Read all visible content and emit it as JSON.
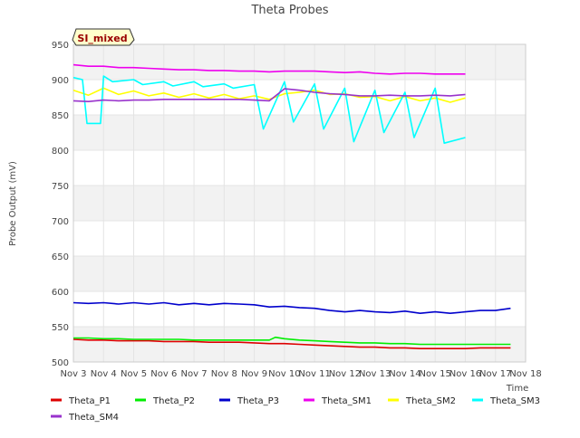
{
  "chart_data": {
    "type": "line",
    "title": "Theta Probes",
    "xlabel": "Time",
    "ylabel": "Probe Output (mV)",
    "annotation": "SI_mixed",
    "xlim": [
      3,
      18
    ],
    "ylim": [
      500,
      950
    ],
    "xticks": [
      {
        "v": 3,
        "label": "Nov 3"
      },
      {
        "v": 4,
        "label": "Nov 4"
      },
      {
        "v": 5,
        "label": "Nov 5"
      },
      {
        "v": 6,
        "label": "Nov 6"
      },
      {
        "v": 7,
        "label": "Nov 7"
      },
      {
        "v": 8,
        "label": "Nov 8"
      },
      {
        "v": 9,
        "label": "Nov 9"
      },
      {
        "v": 10,
        "label": "Nov 10"
      },
      {
        "v": 11,
        "label": "Nov 11"
      },
      {
        "v": 12,
        "label": "Nov 12"
      },
      {
        "v": 13,
        "label": "Nov 13"
      },
      {
        "v": 14,
        "label": "Nov 14"
      },
      {
        "v": 15,
        "label": "Nov 15"
      },
      {
        "v": 16,
        "label": "Nov 16"
      },
      {
        "v": 17,
        "label": "Nov 17"
      },
      {
        "v": 18,
        "label": "Nov 18"
      }
    ],
    "yticks": [
      500,
      550,
      600,
      650,
      700,
      750,
      800,
      850,
      900,
      950
    ],
    "grid": true,
    "legend_position": "bottom",
    "series": [
      {
        "name": "Theta_P1",
        "color": "#dd0000",
        "x": [
          3.0,
          3.5,
          4.0,
          4.5,
          5.0,
          5.5,
          6.0,
          6.5,
          7.0,
          7.5,
          8.0,
          8.5,
          9.0,
          9.5,
          10.0,
          10.5,
          11.0,
          11.5,
          12.0,
          12.5,
          13.0,
          13.5,
          14.0,
          14.5,
          15.0,
          15.5,
          16.0,
          16.5,
          17.0,
          17.5
        ],
        "y": [
          532,
          531,
          531,
          530,
          530,
          530,
          529,
          529,
          529,
          528,
          528,
          528,
          527,
          526,
          526,
          525,
          524,
          523,
          522,
          521,
          521,
          520,
          520,
          519,
          519,
          519,
          519,
          520,
          520,
          520
        ]
      },
      {
        "name": "Theta_P2",
        "color": "#00ee00",
        "x": [
          3.0,
          3.5,
          4.0,
          4.5,
          5.0,
          5.5,
          6.0,
          6.5,
          7.0,
          7.5,
          8.0,
          8.5,
          9.0,
          9.5,
          9.7,
          10.0,
          10.5,
          11.0,
          11.5,
          12.0,
          12.5,
          13.0,
          13.5,
          14.0,
          14.5,
          15.0,
          15.5,
          16.0,
          16.5,
          17.0,
          17.5
        ],
        "y": [
          534,
          534,
          533,
          533,
          532,
          532,
          532,
          532,
          531,
          531,
          531,
          531,
          531,
          531,
          535,
          533,
          531,
          530,
          529,
          528,
          527,
          527,
          526,
          526,
          525,
          525,
          525,
          525,
          525,
          525,
          525
        ]
      },
      {
        "name": "Theta_P3",
        "color": "#0000cc",
        "x": [
          3.0,
          3.5,
          4.0,
          4.5,
          5.0,
          5.5,
          6.0,
          6.5,
          7.0,
          7.5,
          8.0,
          8.5,
          9.0,
          9.5,
          10.0,
          10.5,
          11.0,
          11.5,
          12.0,
          12.5,
          13.0,
          13.5,
          14.0,
          14.5,
          15.0,
          15.5,
          16.0,
          16.5,
          17.0,
          17.5
        ],
        "y": [
          584,
          583,
          584,
          582,
          584,
          582,
          584,
          581,
          583,
          581,
          583,
          582,
          581,
          578,
          579,
          577,
          576,
          573,
          571,
          573,
          571,
          570,
          572,
          569,
          571,
          569,
          571,
          573,
          573,
          576
        ]
      },
      {
        "name": "Theta_SM1",
        "color": "#ee00ee",
        "x": [
          3.0,
          3.5,
          4.0,
          4.5,
          5.0,
          5.5,
          6.0,
          6.5,
          7.0,
          7.5,
          8.0,
          8.5,
          9.0,
          9.5,
          10.0,
          10.5,
          11.0,
          11.5,
          12.0,
          12.5,
          13.0,
          13.5,
          14.0,
          14.5,
          15.0,
          15.5,
          16.0
        ],
        "y": [
          921,
          919,
          919,
          917,
          917,
          916,
          915,
          914,
          914,
          913,
          913,
          912,
          912,
          911,
          912,
          912,
          912,
          911,
          910,
          911,
          909,
          908,
          909,
          909,
          908,
          908,
          908
        ]
      },
      {
        "name": "Theta_SM2",
        "color": "#ffff00",
        "x": [
          3.0,
          3.5,
          4.0,
          4.5,
          5.0,
          5.5,
          6.0,
          6.5,
          7.0,
          7.5,
          8.0,
          8.5,
          9.0,
          9.5,
          10.0,
          10.5,
          11.0,
          11.5,
          12.0,
          12.5,
          13.0,
          13.5,
          14.0,
          14.5,
          15.0,
          15.5,
          16.0
        ],
        "y": [
          885,
          878,
          888,
          879,
          884,
          877,
          881,
          875,
          880,
          874,
          879,
          873,
          877,
          872,
          880,
          882,
          885,
          879,
          880,
          875,
          876,
          870,
          876,
          870,
          874,
          868,
          874
        ]
      },
      {
        "name": "Theta_SM3",
        "color": "#00ffff",
        "x": [
          3.0,
          3.3,
          3.45,
          3.5,
          3.9,
          4.0,
          4.3,
          5.0,
          5.3,
          6.0,
          6.3,
          7.0,
          7.3,
          8.0,
          8.3,
          9.0,
          9.3,
          10.0,
          10.3,
          11.0,
          11.3,
          12.0,
          12.3,
          13.0,
          13.3,
          14.0,
          14.3,
          15.0,
          15.3,
          16.0
        ],
        "y": [
          903,
          900,
          838,
          838,
          838,
          905,
          897,
          900,
          893,
          897,
          891,
          897,
          890,
          894,
          888,
          893,
          830,
          897,
          840,
          894,
          830,
          888,
          812,
          885,
          825,
          882,
          818,
          888,
          810,
          818
        ]
      },
      {
        "name": "Theta_SM4",
        "color": "#9933cc",
        "x": [
          3.0,
          3.5,
          4.0,
          4.5,
          5.0,
          5.5,
          6.0,
          6.5,
          7.0,
          7.5,
          8.0,
          8.5,
          9.0,
          9.5,
          10.0,
          10.5,
          11.0,
          11.5,
          12.0,
          12.5,
          13.0,
          13.5,
          14.0,
          14.5,
          15.0,
          15.5,
          16.0
        ],
        "y": [
          870,
          869,
          871,
          870,
          871,
          871,
          872,
          872,
          872,
          872,
          872,
          872,
          871,
          870,
          887,
          885,
          882,
          880,
          879,
          877,
          877,
          878,
          877,
          877,
          878,
          877,
          879
        ]
      }
    ]
  }
}
